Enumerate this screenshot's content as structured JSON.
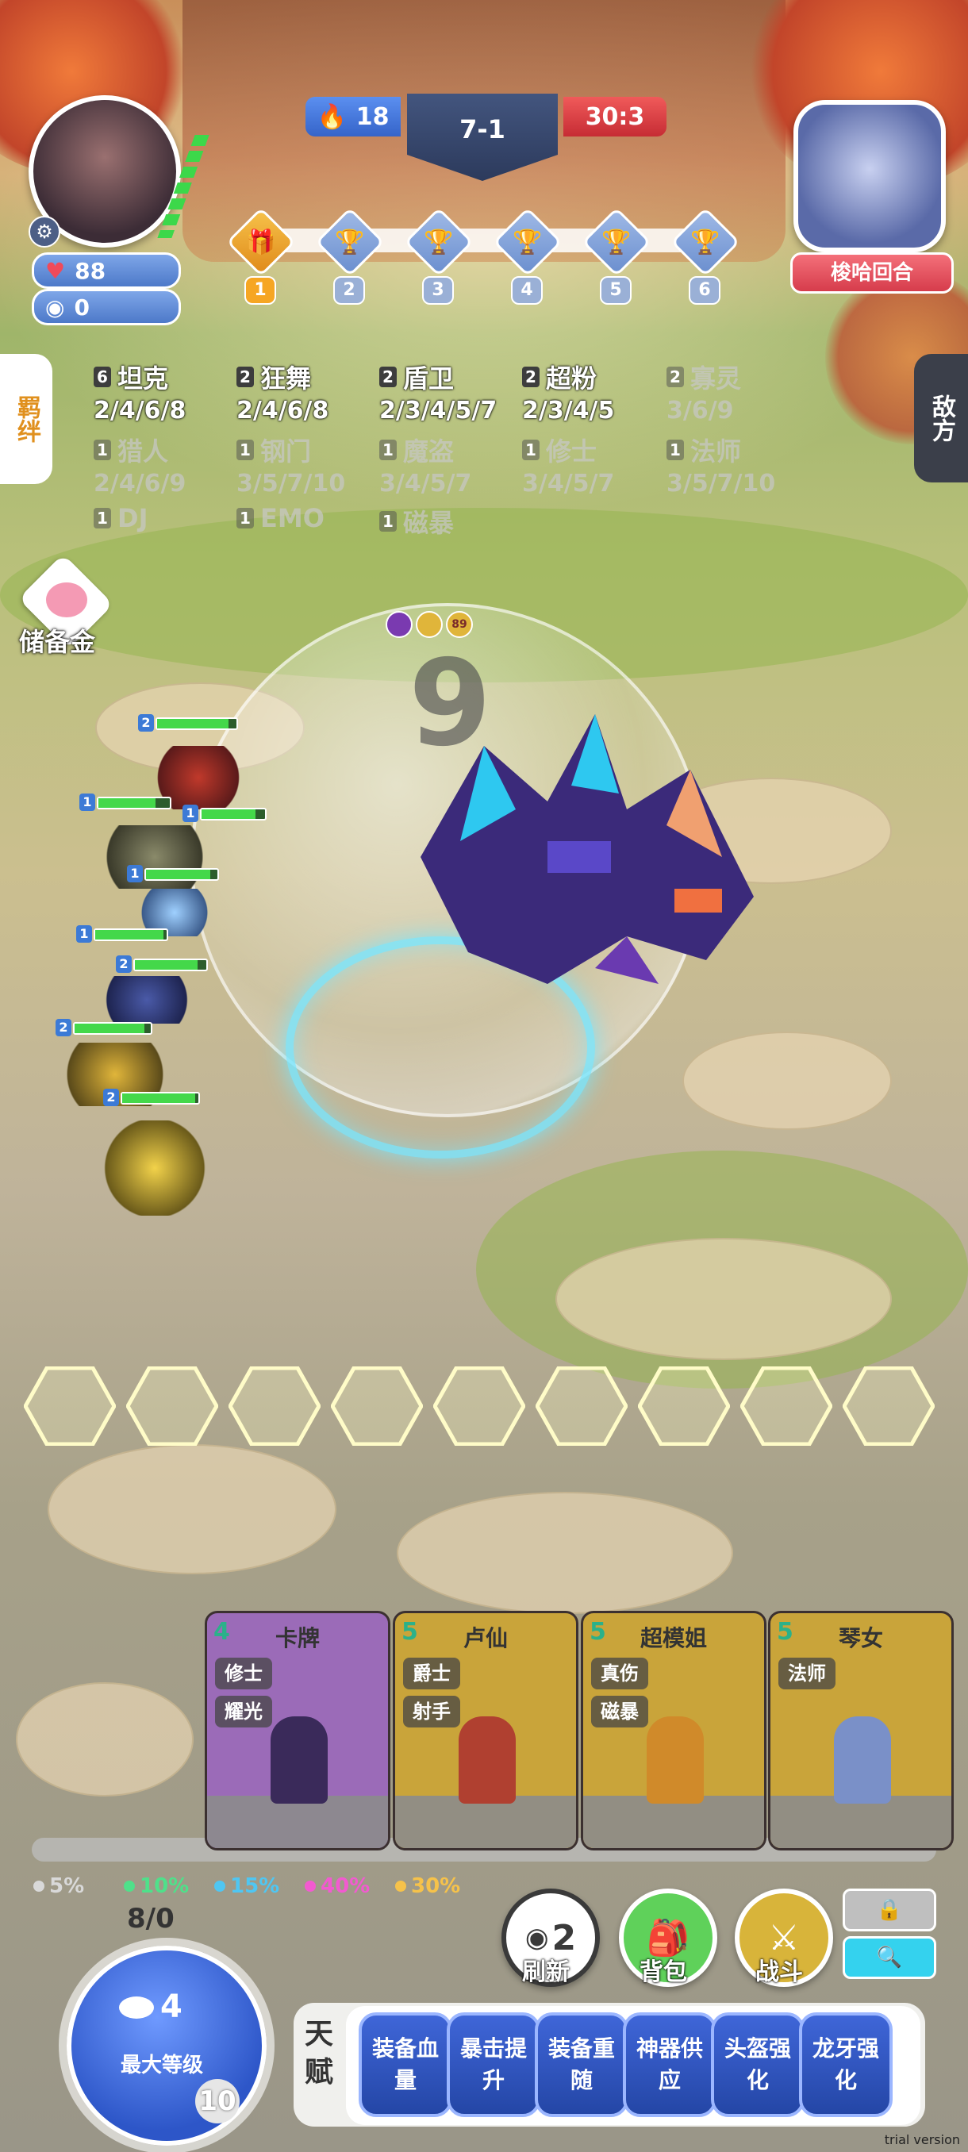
{
  "hud": {
    "hp": "88",
    "gold": "0",
    "streak": "18",
    "round": "7-1",
    "timer": "30:3",
    "opponent_name": "梭哈回合",
    "stage_nodes": [
      "1",
      "2",
      "3",
      "4",
      "5",
      "6"
    ]
  },
  "side": {
    "left_tab": "羁绊",
    "right_tab": "敌方"
  },
  "synergies": [
    {
      "count": "6",
      "name": "坦克",
      "tiers": "2/4/6/8",
      "active": true
    },
    {
      "count": "2",
      "name": "狂舞",
      "tiers": "2/4/6/8",
      "active": true
    },
    {
      "count": "2",
      "name": "盾卫",
      "tiers": "2/3/4/5/7",
      "active": true
    },
    {
      "count": "2",
      "name": "超粉",
      "tiers": "2/3/4/5",
      "active": true
    },
    {
      "count": "2",
      "name": "寡灵",
      "tiers": "3/6/9",
      "active": false
    },
    {
      "count": "1",
      "name": "猎人",
      "tiers": "2/4/6/9",
      "active": false
    },
    {
      "count": "1",
      "name": "钢门",
      "tiers": "3/5/7/10",
      "active": false
    },
    {
      "count": "1",
      "name": "魔盗",
      "tiers": "3/4/5/7",
      "active": false
    },
    {
      "count": "1",
      "name": "修士",
      "tiers": "3/4/5/7",
      "active": false
    },
    {
      "count": "1",
      "name": "法师",
      "tiers": "3/5/7/10",
      "active": false
    },
    {
      "count": "1",
      "name": "DJ",
      "tiers": "",
      "active": false
    },
    {
      "count": "1",
      "name": "EMO",
      "tiers": "",
      "active": false
    },
    {
      "count": "1",
      "name": "磁暴",
      "tiers": "",
      "active": false
    }
  ],
  "piggy_label": "储备金",
  "battle": {
    "damage_number": "9",
    "boss_item_level": "89"
  },
  "shop": {
    "cards": [
      {
        "cost": "4",
        "name": "卡牌",
        "traits": [
          "修士",
          "耀光"
        ],
        "color": "#9b6bb8"
      },
      {
        "cost": "5",
        "name": "卢仙",
        "traits": [
          "爵士",
          "射手"
        ],
        "color": "#c9a43a"
      },
      {
        "cost": "5",
        "name": "超模姐",
        "traits": [
          "真伤",
          "磁暴"
        ],
        "color": "#c9a43a"
      },
      {
        "cost": "5",
        "name": "琴女",
        "traits": [
          "法师"
        ],
        "color": "#c9a43a"
      }
    ]
  },
  "odds": [
    {
      "value": "5%",
      "color": "#d9d9d9"
    },
    {
      "value": "10%",
      "color": "#4fe08a"
    },
    {
      "value": "15%",
      "color": "#4fc6f2"
    },
    {
      "value": "40%",
      "color": "#f25ad0"
    },
    {
      "value": "30%",
      "color": "#f6c24a"
    }
  ],
  "level": {
    "xp": "8/0",
    "price": "4",
    "label": "最大等级",
    "number": "10"
  },
  "actions": {
    "refresh_cost": "2",
    "refresh": "刷新",
    "bag": "背包",
    "fight": "战斗"
  },
  "talents": {
    "head": "天赋",
    "items": [
      "装备血量",
      "暴击提升",
      "装备重随",
      "神器供应",
      "头盔强化",
      "龙牙强化"
    ]
  },
  "watermark": "trial version"
}
